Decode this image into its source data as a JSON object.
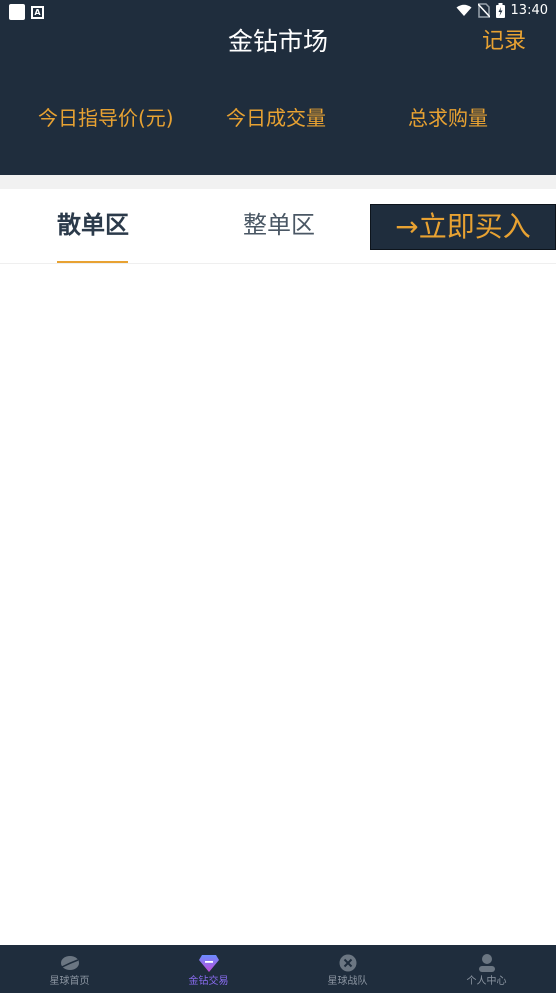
{
  "status_bar": {
    "time": "13:40"
  },
  "header": {
    "title": "金钻市场",
    "record_label": "记录",
    "stats": [
      {
        "label": "今日指导价(元)"
      },
      {
        "label": "今日成交量"
      },
      {
        "label": "总求购量"
      }
    ]
  },
  "tabs": {
    "items": [
      {
        "label": "散单区",
        "active": true
      },
      {
        "label": "整单区",
        "active": false
      }
    ],
    "buy_button_label": "→立即买入"
  },
  "bottom_nav": {
    "items": [
      {
        "label": "星球首页",
        "icon": "planet-icon"
      },
      {
        "label": "金钻交易",
        "icon": "diamond-icon",
        "active": true
      },
      {
        "label": "星球战队",
        "icon": "team-icon"
      },
      {
        "label": "个人中心",
        "icon": "user-icon"
      }
    ]
  },
  "colors": {
    "header_bg": "#1f2d3d",
    "accent_gold": "#e8a232",
    "active_nav": "#8a6cf0",
    "inactive_nav": "#8b95a1"
  }
}
